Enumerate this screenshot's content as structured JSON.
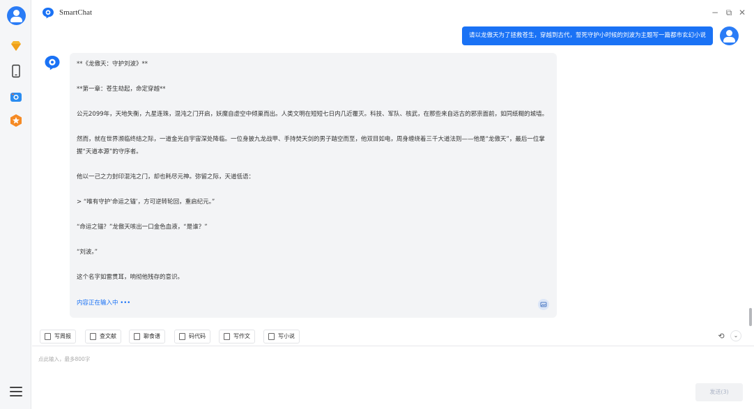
{
  "app": {
    "title": "SmartChat"
  },
  "window": {
    "minimize": "−",
    "maximize": "⧉",
    "close": "✕"
  },
  "sidebar": {
    "items": [
      {
        "name": "profile",
        "icon": "user-avatar-icon"
      },
      {
        "name": "vip",
        "icon": "diamond-icon"
      },
      {
        "name": "phone",
        "icon": "phone-icon"
      },
      {
        "name": "camera",
        "icon": "camera-icon"
      },
      {
        "name": "favorites",
        "icon": "star-badge-icon"
      },
      {
        "name": "menu",
        "icon": "hamburger-menu-icon"
      }
    ]
  },
  "chat": {
    "user_message": "请以龙傲天为了拯救苍生，穿越到古代，誓死守护小时候的刘波为主题写一篇都市玄幻小说",
    "bot_paragraphs": [
      "**《龙傲天：守护刘波》**",
      "**第一章：苍生劫起，命定穿越**",
      "公元2099年，天地失衡，九星连珠，混沌之门开启，妖魔自虚空中倾巢而出。人类文明在短短七日内几近覆灭。科技、军队、核武，在那些来自远古的邪祟面前，如同纸糊的城墙。",
      "然而，就在世界濒临终结之际，一道金光自宇宙深处降临。一位身披九龙战甲、手持焚天剑的男子踏空而至，他双目如电，周身缠绕着三千大道法则——他是“龙傲天”，最后一位掌握“天道本源”的守序者。",
      "他以一己之力封印混沌之门，却也耗尽元神。弥留之际，天道低语：",
      "> “唯有守护‘命运之锚’，方可逆转轮回，重启纪元。”",
      "“命运之锚？”龙傲天咳出一口金色血液，“是谁？”",
      "“刘波。”",
      "这个名字如雷贯耳，响彻他残存的意识。"
    ],
    "typing_status": "内容正在输入中 •••"
  },
  "toolbar": {
    "buttons": [
      {
        "label": "写周报",
        "icon": "report-icon"
      },
      {
        "label": "查文献",
        "icon": "literature-icon"
      },
      {
        "label": "聊食谱",
        "icon": "recipe-icon"
      },
      {
        "label": "码代码",
        "icon": "code-icon"
      },
      {
        "label": "写作文",
        "icon": "essay-icon"
      },
      {
        "label": "写小说",
        "icon": "novel-icon"
      }
    ],
    "refresh": "⟲",
    "collapse": "⌄"
  },
  "input": {
    "placeholder": "点此输入，最多800字",
    "value": "",
    "send_label": "发送(3)"
  },
  "colors": {
    "accent": "#1a72f5",
    "bubble_bg": "#f3f4f6",
    "sidebar_bg": "#f5f6f8"
  }
}
